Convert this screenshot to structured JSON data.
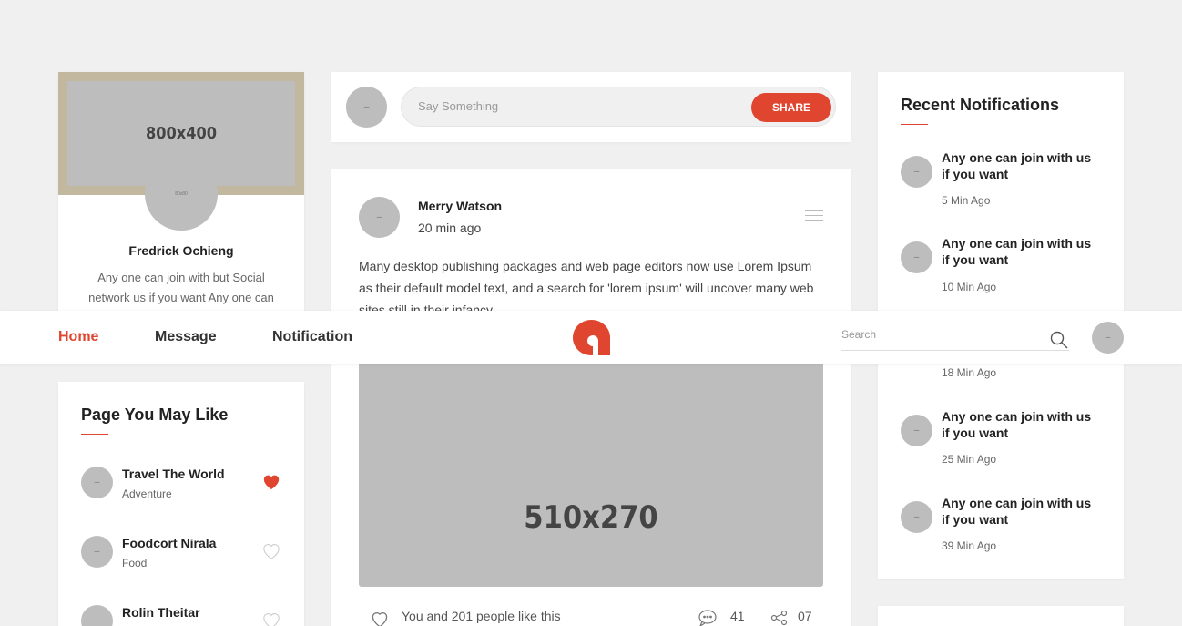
{
  "theme": {
    "accent": "#e0452f",
    "placeholder": "#bdbdbd",
    "cover": "#c2b89f",
    "background": "#f0f0f0"
  },
  "profile": {
    "cover_label": "800x400",
    "avatar_label": "80x80",
    "name": "Fredrick Ochieng",
    "bio": "Any one can join with but Social network us if you want Any one can"
  },
  "composer": {
    "avatar_label": "–",
    "placeholder": "Say Something",
    "share_label": "SHARE"
  },
  "post": {
    "avatar_label": "–",
    "author": "Merry Watson",
    "time": "20 min ago",
    "text": "Many desktop publishing packages and web page editors now use Lorem Ipsum as their default model text, and a search for 'lorem ipsum' will uncover many web sites still in their infancy.",
    "image_label": "510x270",
    "likes_text": "You and 201 people like this",
    "comments": "41",
    "shares": "07",
    "icons": {
      "menu": "menu-icon",
      "like": "heart-outline-icon",
      "comment": "comment-icon",
      "share": "share-icon"
    }
  },
  "pages": {
    "title": "Page You May Like",
    "items": [
      {
        "avatar": "–",
        "name": "Travel The World",
        "category": "Adventure",
        "liked": true
      },
      {
        "avatar": "–",
        "name": "Foodcort Nirala",
        "category": "Food",
        "liked": false
      },
      {
        "avatar": "–",
        "name": "Rolin Theitar",
        "category": "",
        "liked": false
      }
    ]
  },
  "notifications": {
    "title": "Recent Notifications",
    "items": [
      {
        "avatar": "–",
        "text": "Any one can join with us if you want",
        "time": "5 Min Ago"
      },
      {
        "avatar": "–",
        "text": "Any one can join with us if you want",
        "time": "10 Min Ago"
      },
      {
        "avatar": "–",
        "text": "Any one can join with us if you want",
        "time": "25 Min Ago"
      },
      {
        "avatar": "–",
        "text": "Any one can join with us if you want",
        "time": "39 Min Ago"
      }
    ],
    "partial_time": "18 Min Ago"
  },
  "navbar": {
    "links": [
      "Home",
      "Message",
      "Notification"
    ],
    "active": "Home",
    "search_placeholder": "Search",
    "avatar_label": "–",
    "icons": {
      "logo": "logo-icon",
      "search": "search-icon"
    }
  }
}
